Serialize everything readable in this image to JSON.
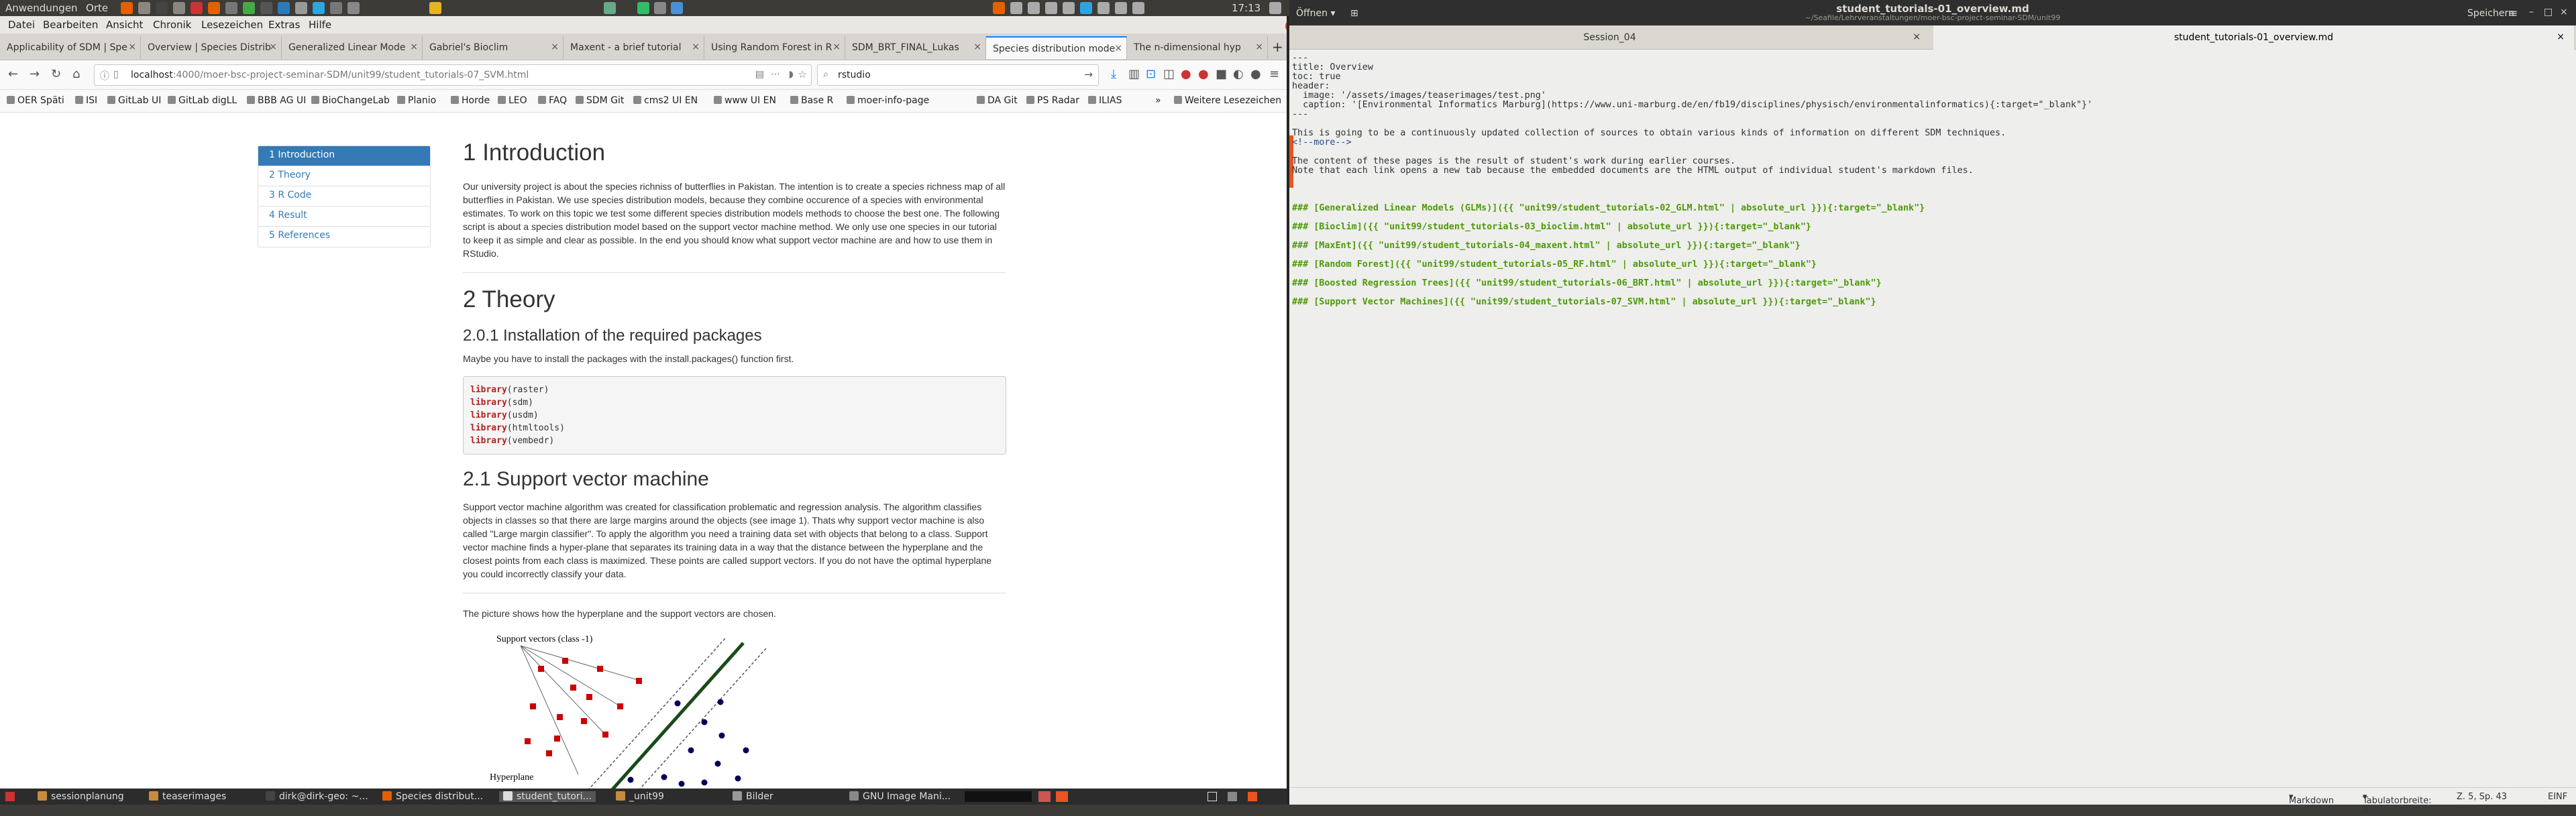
{
  "topbar": {
    "apps": "Anwendungen",
    "places": "Orte",
    "time": "17:13",
    "indicator_icons": [
      "firefox-icon",
      "files-icon",
      "terminal-icon",
      "mail-icon",
      "settings-icon",
      "python-icon",
      "network-icon",
      "sound-icon",
      "battery-icon"
    ]
  },
  "firefox": {
    "menu": [
      "Datei",
      "Bearbeiten",
      "Ansicht",
      "Chronik",
      "Lesezeichen",
      "Extras",
      "Hilfe"
    ],
    "tabs": [
      {
        "label": "Applicability of SDM | Spe"
      },
      {
        "label": "Overview | Species Distrib"
      },
      {
        "label": "Generalized Linear Mode"
      },
      {
        "label": "Gabriel's Bioclim"
      },
      {
        "label": "Maxent - a brief tutorial"
      },
      {
        "label": "Using Random Forest in R"
      },
      {
        "label": "SDM_BRT_FINAL_Lukas"
      },
      {
        "label": "Species distribution mode"
      },
      {
        "label": "The n-dimensional hyp"
      }
    ],
    "url_host": "localhost",
    "url_path": ":4000/moer-bsc-project-seminar-SDM/unit99/student_tutorials-07_SVM.html",
    "search_value": "rstudio",
    "bookmarks": [
      "OER Späti",
      "ISI",
      "GitLab UI",
      "GitLab digLL",
      "BBB AG UI",
      "BioChangeLab",
      "Planio",
      "Horde",
      "LEO",
      "FAQ",
      "SDM Git",
      "cms2 UI EN",
      "www UI EN",
      "Base R",
      "moer-info-page",
      "DA Git",
      "PS Radar",
      "ILIAS"
    ],
    "bookmarks_more": "Weitere Lesezeichen"
  },
  "page": {
    "toc": [
      "1 Introduction",
      "2 Theory",
      "3 R Code",
      "4 Result",
      "5 References"
    ],
    "h_intro": "1 Introduction",
    "intro_text": "Our university project is about the species richniss of butterflies in Pakistan. The intention is to create a species richness map of all butterflies in Pakistan. We use species distribution models, because they combine occurence of a species with environmental estimates. To work on this topic we test some different species distribution models methods to choose the best one. The following script is about a species distribution model based on the support vector machine method. We only use one species in our tutorial to keep it as simple and clear as possible. In the end you should know what support vector machine are and how to use them in RStudio.",
    "h_theory": "2 Theory",
    "h_install": "2.0.1 Installation of the required packages",
    "install_text": "Maybe you have to install the packages with the install.packages() function first.",
    "code_lines": [
      {
        "fn": "library",
        "arg": "(raster)"
      },
      {
        "fn": "library",
        "arg": "(sdm)"
      },
      {
        "fn": "library",
        "arg": "(usdm)"
      },
      {
        "fn": "library",
        "arg": "(htmltools)"
      },
      {
        "fn": "library",
        "arg": "(vembedr)"
      }
    ],
    "h_svm": "2.1 Support vector machine",
    "svm_text": "Support vector machine algorithm was created for classification problematic and regression analysis. The algorithm classifies objects in classes so that there are large margins around the objects (see image 1). Thats why support vector machine is also called \"Large margin classifier\". To apply the algorithm you need a training data set with objects that belong to a class. Support vector machine finds a hyper-plane that separates its training data in a way that the distance between the hyperplane and the closest points from each class is maximized. These points are called support vectors. If you do not have the optimal hyperplane you could incorrectly classify your data.",
    "picture_text": "The picture shows how the hyperplane and the support vectors are chosen.",
    "figure_labels": {
      "support": "Support vectors (class -1)",
      "hyperplane": "Hyperplane"
    }
  },
  "taskbar": [
    "sessionplanung",
    "teaserimages",
    "dirk@dirk-geo: ~...",
    "Species distribut...",
    "student_tutori...",
    "_unit99",
    "Bilder",
    "GNU Image Mani..."
  ],
  "gedit": {
    "open": "Öffnen",
    "save": "Speichern",
    "title": "student_tutorials-01_overview.md",
    "subtitle": "~/Seafile/Lehrveranstaltungen/moer-bsc-project-seminar-SDM/unit99",
    "tabs": [
      "Session_04",
      "student_tutorials-01_overview.md"
    ],
    "lines": [
      "---",
      "title: Overview",
      "toc: true",
      "header:",
      "  image: '/assets/images/teaserimages/test.png'",
      "  caption: '[Environmental Informatics Marburg](https://www.uni-marburg.de/en/fb19/disciplines/physisch/environmentalinformatics){:target=\"_blank\"}'",
      "---",
      "",
      "This is going to be a continuously updated collection of sources to obtain various kinds of information on different SDM techniques.",
      "<!--more-->",
      "",
      "The content of these pages is the result of student's work during earlier courses.",
      "Note that each link opens a new tab because the embedded documents are the HTML output of individual student's markdown files.",
      "",
      "",
      "",
      "### [Generalized Linear Models (GLMs)]({{ \"unit99/student_tutorials-02_GLM.html\" | absolute_url }}){:target=\"_blank\"}",
      "",
      "### [Bioclim]({{ \"unit99/student_tutorials-03_bioclim.html\" | absolute_url }}){:target=\"_blank\"}",
      "",
      "### [MaxEnt]({{ \"unit99/student_tutorials-04_maxent.html\" | absolute_url }}){:target=\"_blank\"}",
      "",
      "### [Random Forest]({{ \"unit99/student_tutorials-05_RF.html\" | absolute_url }}){:target=\"_blank\"}",
      "",
      "### [Boosted Regression Trees]({{ \"unit99/student_tutorials-06_BRT.html\" | absolute_url }}){:target=\"_blank\"}",
      "",
      "### [Support Vector Machines]({{ \"unit99/student_tutorials-07_SVM.html\" | absolute_url }}){:target=\"_blank\"}"
    ],
    "status_lang": "Markdown",
    "status_tab": "Tabulatorbreite: 4",
    "status_pos": "Z. 5, Sp. 43",
    "status_mode": "EINF"
  }
}
